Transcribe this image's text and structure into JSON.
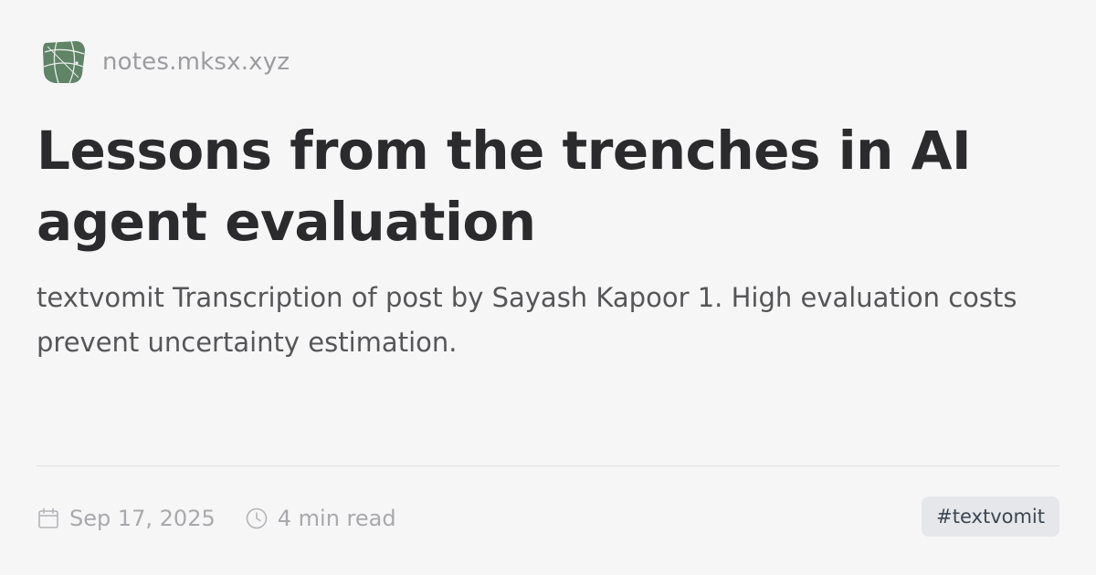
{
  "site": {
    "name": "notes.mksx.xyz",
    "logo_icon": "globe-map-icon"
  },
  "post": {
    "title": "Lessons from the trenches in AI agent evaluation",
    "excerpt": "textvomit Transcription of post by Sayash Kapoor 1. High evaluation costs prevent uncertainty estimation.",
    "date": "Sep 17, 2025",
    "read_time": "4 min read",
    "tag": "#textvomit"
  },
  "icons": {
    "date": "calendar-icon",
    "read_time": "clock-icon"
  },
  "colors": {
    "background": "#f6f6f7",
    "title": "#2b2b2d",
    "muted": "#a9a9ad",
    "logo": "#5f8466",
    "tag_background": "#e5e7ea"
  }
}
